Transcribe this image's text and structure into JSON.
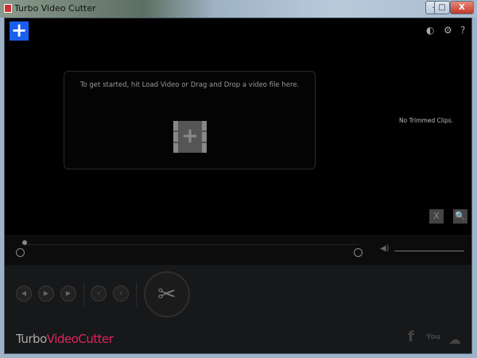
{
  "window": {
    "title": "Turbo Video Cutter",
    "minimize": "–",
    "maximize": "□",
    "close": "X"
  },
  "toolbar": {
    "add_label": "+",
    "theme_icon": "◐",
    "settings_icon": "⚙",
    "help_label": "?"
  },
  "dropzone": {
    "text": "To get started, hit Load Video or Drag and Drop a video file here.",
    "add_icon": "+"
  },
  "clips": {
    "empty_text": "No Trimmed Clips."
  },
  "clip_actions": {
    "clear_icon": "X",
    "browse_icon": "🔍"
  },
  "controls": {
    "prev_frame": "◀",
    "play": "▶",
    "next_frame": "▶",
    "mark_in": "‹",
    "mark_out": "›",
    "cut": "✂"
  },
  "brand": {
    "turbo": "Turbo",
    "video_cutter": "VideoCutter"
  },
  "social": {
    "facebook": "f",
    "youtube": "You",
    "cloud": "☁"
  }
}
